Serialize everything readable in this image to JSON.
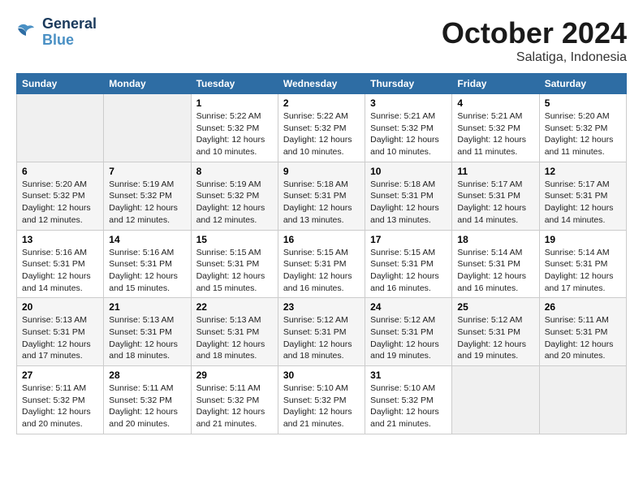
{
  "header": {
    "logo_line1": "General",
    "logo_line2": "Blue",
    "month_title": "October 2024",
    "location": "Salatiga, Indonesia"
  },
  "weekdays": [
    "Sunday",
    "Monday",
    "Tuesday",
    "Wednesday",
    "Thursday",
    "Friday",
    "Saturday"
  ],
  "weeks": [
    [
      {
        "day": "",
        "info": ""
      },
      {
        "day": "",
        "info": ""
      },
      {
        "day": "1",
        "info": "Sunrise: 5:22 AM\nSunset: 5:32 PM\nDaylight: 12 hours\nand 10 minutes."
      },
      {
        "day": "2",
        "info": "Sunrise: 5:22 AM\nSunset: 5:32 PM\nDaylight: 12 hours\nand 10 minutes."
      },
      {
        "day": "3",
        "info": "Sunrise: 5:21 AM\nSunset: 5:32 PM\nDaylight: 12 hours\nand 10 minutes."
      },
      {
        "day": "4",
        "info": "Sunrise: 5:21 AM\nSunset: 5:32 PM\nDaylight: 12 hours\nand 11 minutes."
      },
      {
        "day": "5",
        "info": "Sunrise: 5:20 AM\nSunset: 5:32 PM\nDaylight: 12 hours\nand 11 minutes."
      }
    ],
    [
      {
        "day": "6",
        "info": "Sunrise: 5:20 AM\nSunset: 5:32 PM\nDaylight: 12 hours\nand 12 minutes."
      },
      {
        "day": "7",
        "info": "Sunrise: 5:19 AM\nSunset: 5:32 PM\nDaylight: 12 hours\nand 12 minutes."
      },
      {
        "day": "8",
        "info": "Sunrise: 5:19 AM\nSunset: 5:32 PM\nDaylight: 12 hours\nand 12 minutes."
      },
      {
        "day": "9",
        "info": "Sunrise: 5:18 AM\nSunset: 5:31 PM\nDaylight: 12 hours\nand 13 minutes."
      },
      {
        "day": "10",
        "info": "Sunrise: 5:18 AM\nSunset: 5:31 PM\nDaylight: 12 hours\nand 13 minutes."
      },
      {
        "day": "11",
        "info": "Sunrise: 5:17 AM\nSunset: 5:31 PM\nDaylight: 12 hours\nand 14 minutes."
      },
      {
        "day": "12",
        "info": "Sunrise: 5:17 AM\nSunset: 5:31 PM\nDaylight: 12 hours\nand 14 minutes."
      }
    ],
    [
      {
        "day": "13",
        "info": "Sunrise: 5:16 AM\nSunset: 5:31 PM\nDaylight: 12 hours\nand 14 minutes."
      },
      {
        "day": "14",
        "info": "Sunrise: 5:16 AM\nSunset: 5:31 PM\nDaylight: 12 hours\nand 15 minutes."
      },
      {
        "day": "15",
        "info": "Sunrise: 5:15 AM\nSunset: 5:31 PM\nDaylight: 12 hours\nand 15 minutes."
      },
      {
        "day": "16",
        "info": "Sunrise: 5:15 AM\nSunset: 5:31 PM\nDaylight: 12 hours\nand 16 minutes."
      },
      {
        "day": "17",
        "info": "Sunrise: 5:15 AM\nSunset: 5:31 PM\nDaylight: 12 hours\nand 16 minutes."
      },
      {
        "day": "18",
        "info": "Sunrise: 5:14 AM\nSunset: 5:31 PM\nDaylight: 12 hours\nand 16 minutes."
      },
      {
        "day": "19",
        "info": "Sunrise: 5:14 AM\nSunset: 5:31 PM\nDaylight: 12 hours\nand 17 minutes."
      }
    ],
    [
      {
        "day": "20",
        "info": "Sunrise: 5:13 AM\nSunset: 5:31 PM\nDaylight: 12 hours\nand 17 minutes."
      },
      {
        "day": "21",
        "info": "Sunrise: 5:13 AM\nSunset: 5:31 PM\nDaylight: 12 hours\nand 18 minutes."
      },
      {
        "day": "22",
        "info": "Sunrise: 5:13 AM\nSunset: 5:31 PM\nDaylight: 12 hours\nand 18 minutes."
      },
      {
        "day": "23",
        "info": "Sunrise: 5:12 AM\nSunset: 5:31 PM\nDaylight: 12 hours\nand 18 minutes."
      },
      {
        "day": "24",
        "info": "Sunrise: 5:12 AM\nSunset: 5:31 PM\nDaylight: 12 hours\nand 19 minutes."
      },
      {
        "day": "25",
        "info": "Sunrise: 5:12 AM\nSunset: 5:31 PM\nDaylight: 12 hours\nand 19 minutes."
      },
      {
        "day": "26",
        "info": "Sunrise: 5:11 AM\nSunset: 5:31 PM\nDaylight: 12 hours\nand 20 minutes."
      }
    ],
    [
      {
        "day": "27",
        "info": "Sunrise: 5:11 AM\nSunset: 5:32 PM\nDaylight: 12 hours\nand 20 minutes."
      },
      {
        "day": "28",
        "info": "Sunrise: 5:11 AM\nSunset: 5:32 PM\nDaylight: 12 hours\nand 20 minutes."
      },
      {
        "day": "29",
        "info": "Sunrise: 5:11 AM\nSunset: 5:32 PM\nDaylight: 12 hours\nand 21 minutes."
      },
      {
        "day": "30",
        "info": "Sunrise: 5:10 AM\nSunset: 5:32 PM\nDaylight: 12 hours\nand 21 minutes."
      },
      {
        "day": "31",
        "info": "Sunrise: 5:10 AM\nSunset: 5:32 PM\nDaylight: 12 hours\nand 21 minutes."
      },
      {
        "day": "",
        "info": ""
      },
      {
        "day": "",
        "info": ""
      }
    ]
  ]
}
